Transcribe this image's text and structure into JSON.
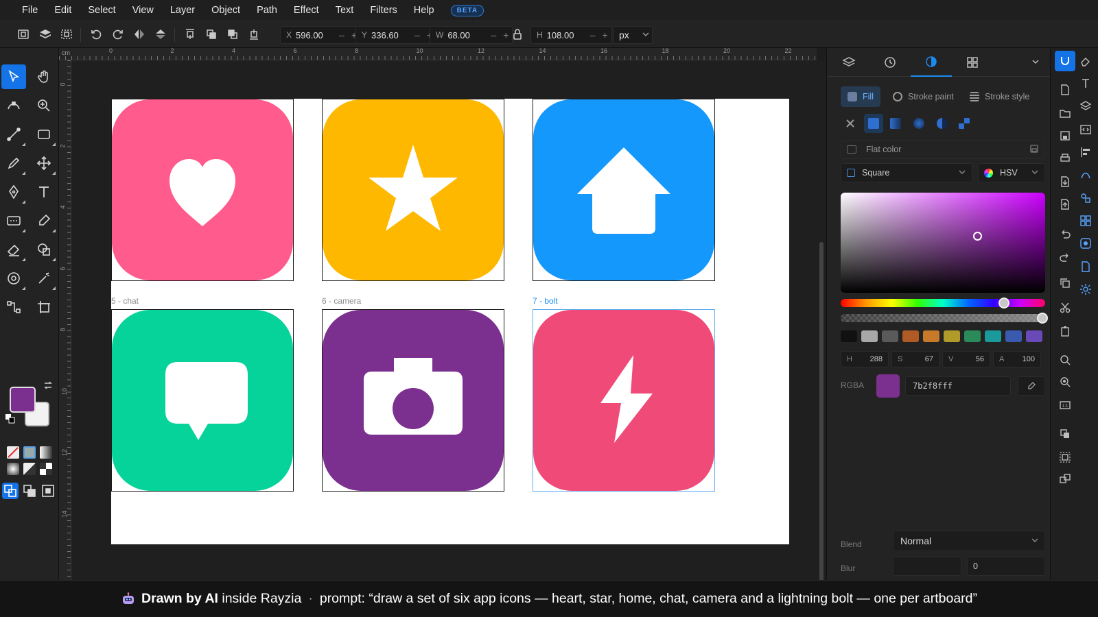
{
  "menubar": {
    "items": [
      "File",
      "Edit",
      "Select",
      "View",
      "Layer",
      "Object",
      "Path",
      "Effect",
      "Text",
      "Filters",
      "Help"
    ],
    "badge": "BETA"
  },
  "toolbar": {
    "x": {
      "label": "X",
      "value": "596.00"
    },
    "y": {
      "label": "Y",
      "value": "336.60"
    },
    "w": {
      "label": "W",
      "value": "68.00"
    },
    "h": {
      "label": "H",
      "value": "108.00"
    },
    "minus": "–",
    "plus": "+",
    "unit": "px"
  },
  "rulers": {
    "unit": "cm",
    "top_ticks": [
      "0",
      "2",
      "4",
      "6",
      "8",
      "10",
      "12",
      "14",
      "16",
      "18",
      "20",
      "22"
    ],
    "left_ticks": [
      "0",
      "2",
      "4",
      "6",
      "8",
      "10",
      "12",
      "14"
    ]
  },
  "artboards": [
    {
      "label": "",
      "icon": "heart-icon",
      "color": "#ff5b8c"
    },
    {
      "label": "",
      "icon": "star-icon",
      "color": "#ffb800"
    },
    {
      "label": "",
      "icon": "home-icon",
      "color": "#1598fb"
    },
    {
      "label": "5 - chat",
      "icon": "chat-icon",
      "color": "#06d39a"
    },
    {
      "label": "6 - camera",
      "icon": "camera-icon",
      "color": "#7b2f8f"
    },
    {
      "label": "7 - bolt",
      "icon": "bolt-icon",
      "color": "#f04a78",
      "selected": true
    }
  ],
  "fill_panel": {
    "tabs": [
      "Fill",
      "Stroke paint",
      "Stroke style"
    ],
    "mode": "Flat color",
    "shape_select": "Square",
    "model_select": "HSV",
    "hsva": [
      {
        "label": "H",
        "value": "288"
      },
      {
        "label": "S",
        "value": "67"
      },
      {
        "label": "V",
        "value": "56"
      },
      {
        "label": "A",
        "value": "100"
      }
    ],
    "rgba_label": "RGBA",
    "rgba_value": "7b2f8fff",
    "current_color": "#7b2f8f",
    "hue_fraction": 0.8,
    "alpha_fraction": 1.0,
    "palette": [
      "#111111",
      "#a8a8a8",
      "#5a5a5a",
      "#b05a26",
      "#c87a2a",
      "#b09a2a",
      "#2a8a5a",
      "#1a9a9a",
      "#3a5ab0",
      "#6a4ab8"
    ],
    "blend_label": "Blend",
    "blend_value": "Normal",
    "blur_label": "Blur",
    "blur_value": "0"
  },
  "caption": {
    "strong": "Drawn by AI",
    "rest": " inside Rayzia",
    "dot": "·",
    "prompt": "prompt: “draw a set of six app icons — heart, star, home, chat, camera and a lightning bolt — one per artboard”"
  }
}
